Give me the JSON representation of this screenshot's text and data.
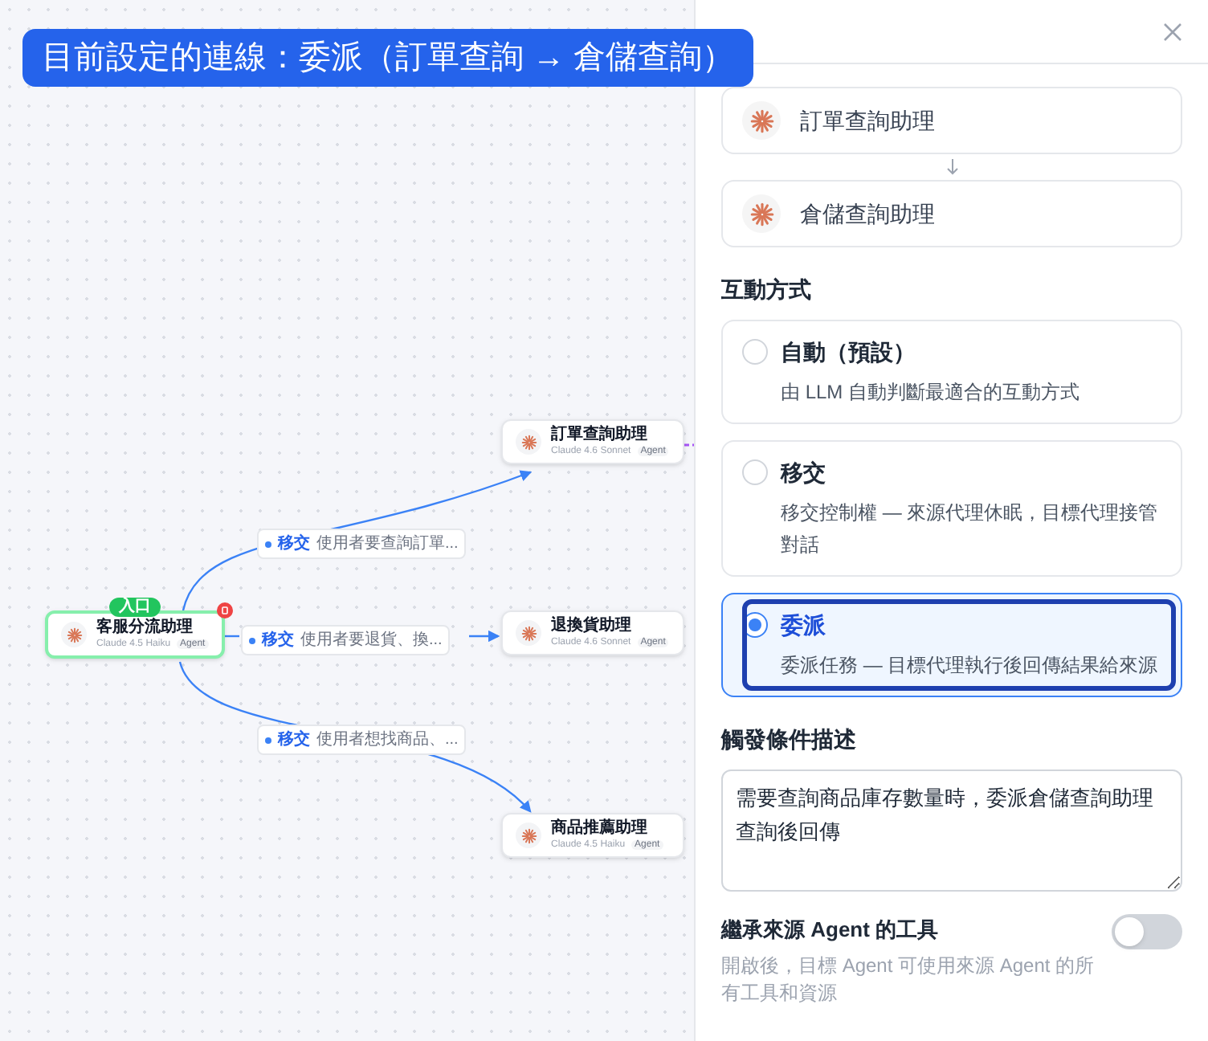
{
  "banner": "目前設定的連線：委派（訂單查詢 → 倉儲查詢）",
  "canvas": {
    "nodes": [
      {
        "name": "客服分流助理",
        "model": "Claude 4.5 Haiku",
        "tag": "Agent",
        "badge": "入口",
        "selected": true
      },
      {
        "name": "訂單查詢助理",
        "model": "Claude 4.6 Sonnet",
        "tag": "Agent",
        "selected": false
      },
      {
        "name": "退換貨助理",
        "model": "Claude 4.6 Sonnet",
        "tag": "Agent",
        "selected": false
      },
      {
        "name": "商品推薦助理",
        "model": "Claude 4.5 Haiku",
        "tag": "Agent",
        "selected": false
      }
    ],
    "edges": [
      {
        "type": "移交",
        "description": "使用者要查詢訂單..."
      },
      {
        "type": "移交",
        "description": "使用者要退貨、換..."
      },
      {
        "type": "移交",
        "description": "使用者想找商品、..."
      }
    ]
  },
  "panel": {
    "route": [
      {
        "name": "訂單查詢助理"
      },
      {
        "name": "倉儲查詢助理"
      }
    ],
    "interaction_heading": "互動方式",
    "options": [
      {
        "title": "自動（預設）",
        "description": "由 LLM 自動判斷最適合的互動方式",
        "selected": false
      },
      {
        "title": "移交",
        "description": "移交控制權 — 來源代理休眠，目標代理接管對話",
        "selected": false
      },
      {
        "title": "委派",
        "description": "委派任務 — 目標代理執行後回傳結果給來源",
        "selected": true
      }
    ],
    "trigger": {
      "label": "觸發條件描述",
      "value": "需要查詢商品庫存數量時，委派倉儲查詢助理查詢後回傳"
    },
    "inherit": {
      "label": "繼承來源 Agent 的工具",
      "description": "開啟後，目標 Agent 可使用來源 Agent 的所有工具和資源",
      "on": false
    }
  }
}
